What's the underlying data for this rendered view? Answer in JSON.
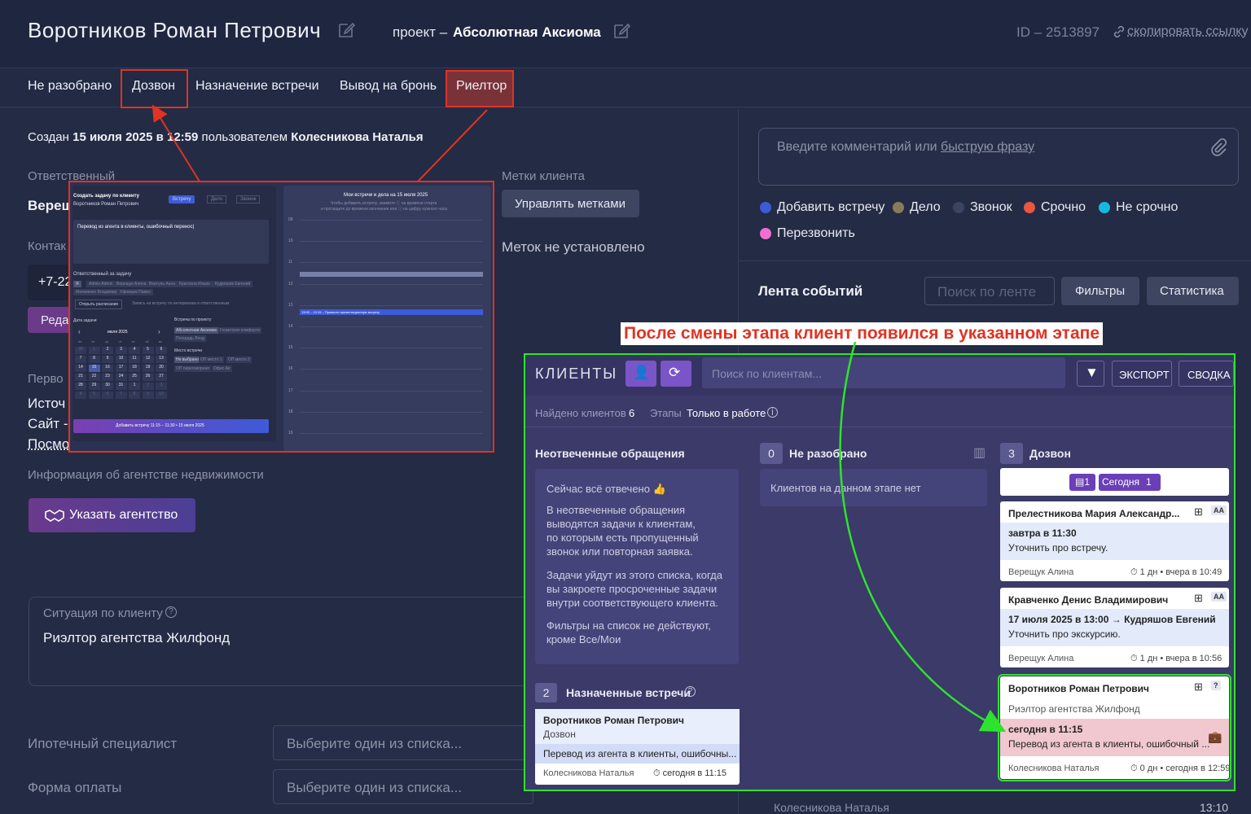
{
  "header": {
    "client_name": "Воротников Роман Петрович",
    "project_prefix": "проект – ",
    "project_name": "Абсолютная Аксиома",
    "id_text": "ID – 2513897",
    "copy_link": "скопировать ссылку"
  },
  "tabs": [
    "Не разобрано",
    "Дозвон",
    "Назначение встречи",
    "Вывод на бронь",
    "Риелтор"
  ],
  "created": {
    "prefix": "Создан ",
    "date": "15 июля 2025 в 12:59",
    "mid": " пользователем ",
    "user": "Колесникова Наталья"
  },
  "left": {
    "responsible_label": "Ответственный",
    "responsible_value": "Вереш",
    "contact_label": "Контак",
    "phone": "+7-22",
    "edit_btn": "Реда",
    "first_label": "Перво",
    "source1": "Источ",
    "source2": "Сайт -",
    "source3": "Посмо",
    "agency_label": "Информация об агентстве недвижимости",
    "agency_btn": "Указать агентство",
    "situation_label": "Ситуация по клиенту",
    "situation_value": "Риэлтор агентства Жилфонд",
    "mortgage_label": "Ипотечный специалист",
    "mortgage_placeholder": "Выберите один из списка...",
    "payment_label": "Форма оплаты",
    "payment_placeholder": "Выберите один из списка..."
  },
  "tags": {
    "label": "Метки клиента",
    "manage_btn": "Управлять метками",
    "none_text": "Меток не установлено"
  },
  "overlay": {
    "title": "Создать задачу по клиенту",
    "client": "Воротников Роман Петрович",
    "tab_meeting": "Встречу",
    "tab_task": "Дело",
    "tab_call": "Звонок",
    "textarea": "Перевод из агента в клиенты, ошибочный перенос|",
    "resp_label": "Ответственный за задачу",
    "resp_people": [
      "Я",
      "Admin Admin",
      "Верещук Алина",
      "Вертупь Анна",
      "Кристина Ильин",
      "Кудряшов Евгений",
      "Матвиенко Владимир",
      "Уфимцев Павел"
    ],
    "schedule_btn": "Открыть расписание",
    "schedule_hint": "Запись на встречу по интервалам и ответственным",
    "date_label": "Дата задачи",
    "month": "июля 2025",
    "weekdays": [
      "пн",
      "вт",
      "ср",
      "чт",
      "пт",
      "сб",
      "вс"
    ],
    "days": [
      "30",
      "1",
      "2",
      "3",
      "4",
      "5",
      "6",
      "7",
      "8",
      "9",
      "10",
      "11",
      "12",
      "13",
      "14",
      "15",
      "16",
      "17",
      "18",
      "19",
      "20",
      "21",
      "22",
      "23",
      "24",
      "25",
      "26",
      "27",
      "28",
      "29",
      "30",
      "31",
      "1",
      "2",
      "3",
      "4",
      "5",
      "6",
      "7",
      "8",
      "9",
      "10"
    ],
    "project_label": "Встреча по проекту",
    "projects": [
      "Абсолютная Аксиома",
      "Геометрия комфорта",
      "Площадь Ленд"
    ],
    "place_label": "Место встречи",
    "places": [
      "Не выбрано",
      "ОП место 1",
      "ОП место 2",
      "ОП переговорная",
      "Офис Air"
    ],
    "submit": "Добавить встречу 11:15 – 11:30 • 15 июля 2025",
    "cal_title": "Мои встречи и дела на 15 июля 2025",
    "cal_hint1": "Чтобы добавить встречу, зажмите ⓘ на времени старта",
    "cal_hint2": "и протащите до времени окончания или ⓘ на цифру нужного часа",
    "hours": [
      "09",
      "10",
      "11",
      "12",
      "13",
      "14",
      "15",
      "16",
      "17",
      "18",
      "19"
    ],
    "event": "13:00 – 13:15 – Провести презентационную встречу"
  },
  "comment": {
    "placeholder_prefix": "Введите комментарий или ",
    "placeholder_link": "быструю фразу"
  },
  "chips": [
    {
      "label": "Добавить встречу",
      "color": "#3d5bd9"
    },
    {
      "label": "Дело",
      "color": "#8a7a5c"
    },
    {
      "label": "Звонок",
      "color": "#3b4460"
    },
    {
      "label": "Срочно",
      "color": "#e9573f"
    },
    {
      "label": "Не срочно",
      "color": "#16b8e0"
    },
    {
      "label": "Перезвонить",
      "color": "#f06fd0"
    }
  ],
  "feed": {
    "title": "Лента событий",
    "search_placeholder": "Поиск по ленте",
    "filters_btn": "Фильтры",
    "stats_btn": "Статистика",
    "bottom_user": "Колесникова Наталья",
    "bottom_time": "13:10"
  },
  "annotation": "После смены этапа клиент появился в указанном этапе",
  "clients": {
    "title": "КЛИЕНТЫ",
    "search_placeholder": "Поиск по клиентам...",
    "export_btn": "ЭКСПОРТ",
    "summary_btn": "СВОДКА",
    "found_label": "Найдено клиентов",
    "found_count": "6",
    "stages_label": "Этапы",
    "stages_value": "Только в работе",
    "unanswered": {
      "title": "Неотвеченные обращения",
      "line1": "Сейчас всё отвечено 👍",
      "p1": [
        "В неотвеченные обращения",
        "выводятся задачи к клиентам,",
        "по которым есть пропущенный",
        "звонок или повторная заявка."
      ],
      "p2": [
        "Задачи уйдут из этого списка, когда",
        "вы закроете просроченные задачи",
        "внутри соответствующего клиента."
      ],
      "p3": [
        "Фильтры на список не действуют,",
        "кроме Все/Мои"
      ]
    },
    "assigned": {
      "count": "2",
      "title": "Назначенные встречи",
      "card_name": "Воротников Роман Петрович",
      "card_stage": "Дозвон",
      "card_task": "Перевод из агента в клиенты, ошибочны...",
      "card_user": "Колесникова Наталья",
      "card_time": "сегодня в 11:15"
    },
    "unsorted": {
      "count": "0",
      "title": "Не разобрано",
      "empty": "Клиентов на данном этапе нет"
    },
    "dozvon": {
      "count": "3",
      "title": "Дозвон",
      "badge_count": "1",
      "today_label": "Сегодня",
      "today_count": "1",
      "cards": [
        {
          "name": "Прелестникова Мария Александр...",
          "tag": "AA",
          "when": "завтра в 11:30",
          "task": "Уточнить про встречу.",
          "user": "Верещук Алина",
          "meta": "1 дн • вчера в 10:49"
        },
        {
          "name": "Кравченко Денис Владимирович",
          "tag": "AA",
          "when": "17 июля 2025 в 13:00 → Кудряшов Евгений",
          "task": "Уточнить про экскурсию.",
          "user": "Верещук Алина",
          "meta": "1 дн • вчера в 10:56"
        },
        {
          "name": "Воротников Роман Петрович",
          "tag": "?",
          "sub": "Риэлтор агентства Жилфонд",
          "when": "сегодня в 11:15",
          "task": "Перевод из агента в клиенты, ошибочный ...",
          "user": "Колесникова Наталья",
          "meta": "0 дн • сегодня в 12:59"
        }
      ]
    }
  }
}
